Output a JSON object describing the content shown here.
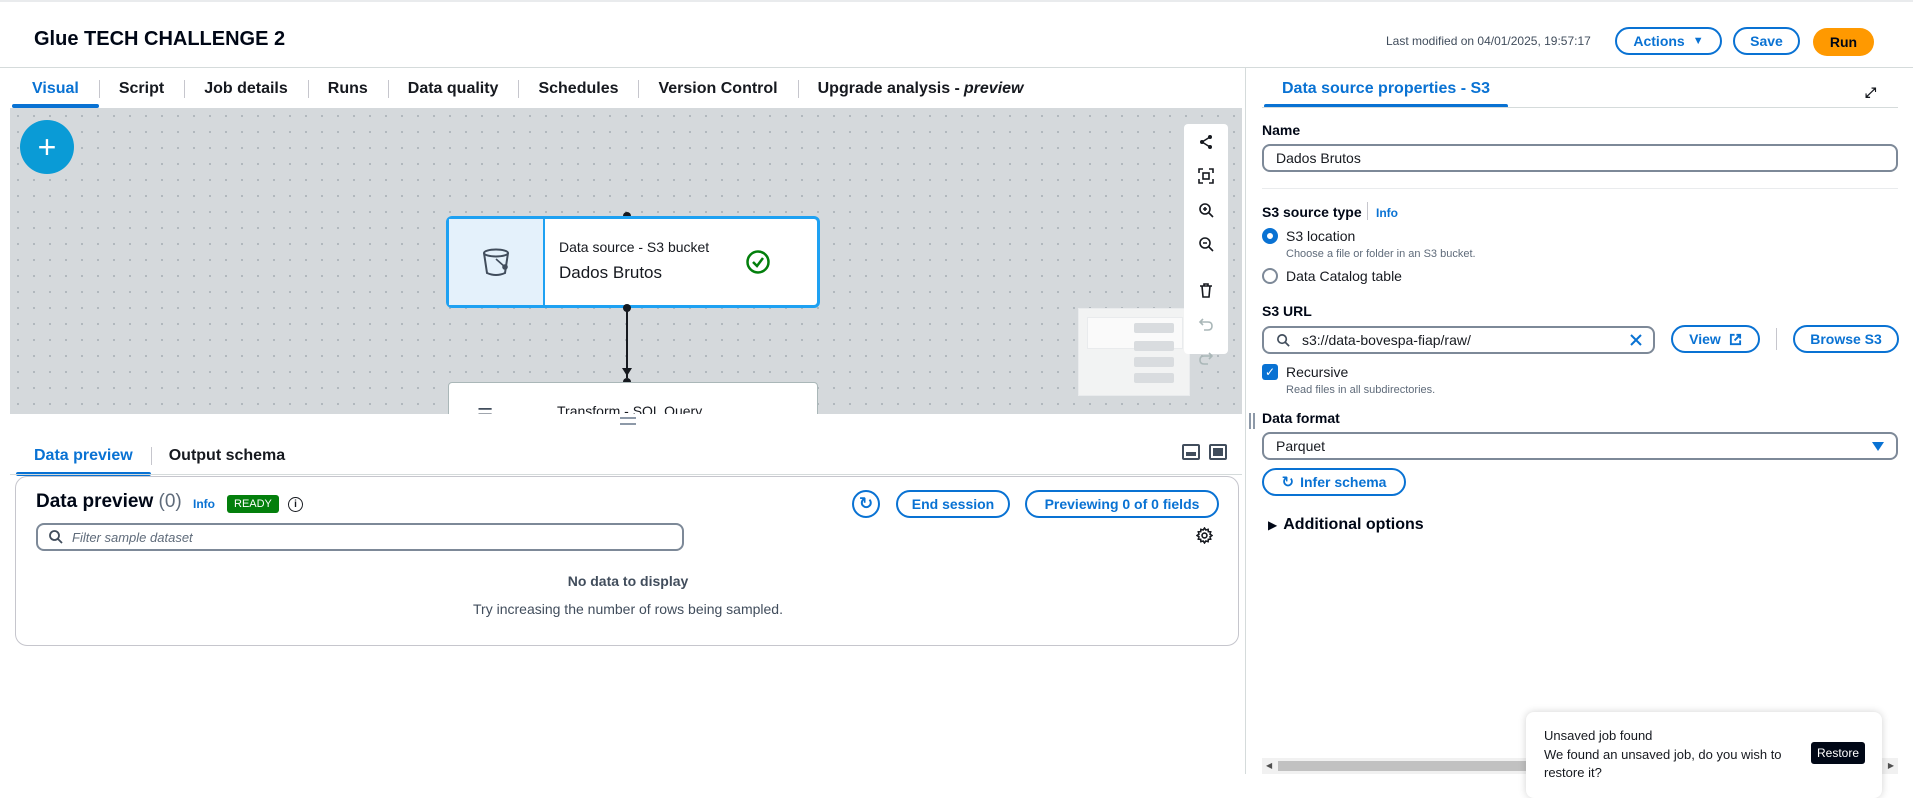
{
  "header": {
    "job_title": "Glue TECH CHALLENGE 2",
    "last_modified": "Last modified on 04/01/2025, 19:57:17",
    "actions_label": "Actions",
    "save_label": "Save",
    "run_label": "Run"
  },
  "tabs": [
    {
      "label": "Visual"
    },
    {
      "label": "Script"
    },
    {
      "label": "Job details"
    },
    {
      "label": "Runs"
    },
    {
      "label": "Data quality"
    },
    {
      "label": "Schedules"
    },
    {
      "label": "Version Control"
    },
    {
      "label": "Upgrade analysis -",
      "suffix": "preview"
    }
  ],
  "canvas": {
    "add_label": "+",
    "source_node": {
      "type": "Data source - S3 bucket",
      "name": "Dados Brutos"
    },
    "transform_node": {
      "type": "Transform - SQL Query"
    }
  },
  "bottom_tabs": [
    {
      "label": "Data preview"
    },
    {
      "label": "Output schema"
    }
  ],
  "preview": {
    "title": "Data preview",
    "count": "(0)",
    "info": "Info",
    "status": "READY",
    "end_session": "End session",
    "previewing": "Previewing 0 of 0 fields",
    "filter_placeholder": "Filter sample dataset",
    "empty_title": "No data to display",
    "empty_desc": "Try increasing the number of rows being sampled."
  },
  "panel": {
    "tab_label": "Data source properties - S3",
    "name_label": "Name",
    "name_value": "Dados Brutos",
    "source_type_label": "S3 source type",
    "source_type_info": "Info",
    "opt_s3_location": "S3 location",
    "opt_s3_location_desc": "Choose a file or folder in an S3 bucket.",
    "opt_catalog": "Data Catalog table",
    "s3_url_label": "S3 URL",
    "s3_url_value": "s3://data-bovespa-fiap/raw/",
    "view_label": "View",
    "browse_label": "Browse S3",
    "recursive_label": "Recursive",
    "recursive_desc": "Read files in all subdirectories.",
    "format_label": "Data format",
    "format_value": "Parquet",
    "infer_label": "Infer schema",
    "additional_label": "Additional options"
  },
  "toast": {
    "title": "Unsaved job found",
    "message": "We found an unsaved job, do you wish to restore it?",
    "restore_label": "Restore"
  },
  "colors": {
    "accent": "#0972d3",
    "run": "#ff9900",
    "ready": "#037f0c",
    "node_border": "#1ea1f2"
  }
}
